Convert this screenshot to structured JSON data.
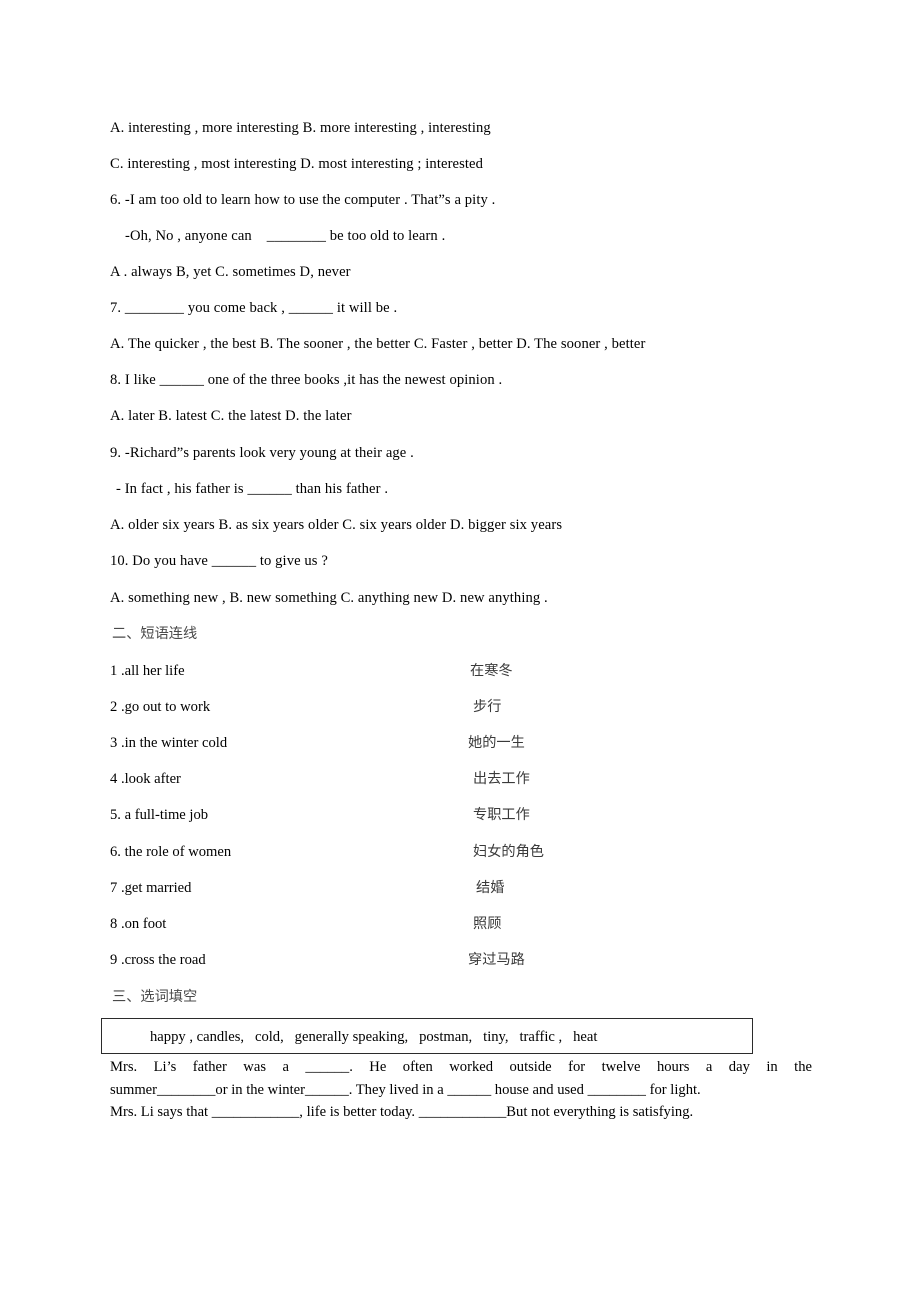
{
  "document": {
    "multiple_choice": {
      "lines": [
        {
          "id": "q5-options-ab",
          "text": "A. interesting , more interesting B. more interesting , interesting"
        },
        {
          "id": "q5-options-cd",
          "text": "C. interesting , most interesting D. most interesting ; interested"
        },
        {
          "id": "q6-stem",
          "text": "6. -I am too old to learn how to use the computer . That”s a pity ."
        },
        {
          "id": "q6-reply",
          "text": "-Oh, No , anyone can    ________ be too old to learn ."
        },
        {
          "id": "q6-options",
          "text": "A . always B, yet C. sometimes D, never"
        },
        {
          "id": "q7-stem",
          "text": "7. ________ you come back , ______ it will be ."
        },
        {
          "id": "q7-options",
          "text": "A. The quicker , the best B. The sooner , the better C. Faster , better D. The sooner , better"
        },
        {
          "id": "q8-stem",
          "text": "8. I like ______ one of the three books ,it has the newest opinion ."
        },
        {
          "id": "q8-options",
          "text": "A. later B. latest C. the latest D. the later"
        },
        {
          "id": "q9-stem",
          "text": "9. -Richard”s parents look very young at their age ."
        },
        {
          "id": "q9-reply",
          "text": "- In fact , his father is ______ than his father ."
        },
        {
          "id": "q9-options",
          "text": "A. older six years B. as six years older C. six years older D. bigger six years"
        },
        {
          "id": "q10-stem",
          "text": "10. Do you have ______ to give us ?"
        },
        {
          "id": "q10-options",
          "text": "A. something new , B. new something C. anything new D. new anything ."
        }
      ]
    },
    "section_two": {
      "heading": "二、短语连线",
      "english": [
        "1 .all her life",
        "2 .go out to work",
        "3 .in the winter cold",
        "4 .look after",
        "5. a full-time job",
        "6. the role of women",
        "7 .get married",
        "8 .on foot",
        "9 .cross the road"
      ],
      "chinese": [
        "在寒冬",
        "步行",
        "她的一生",
        "出去工作",
        "专职工作",
        "妇女的角色",
        "结婚",
        "照顾",
        "穿过马路"
      ]
    },
    "section_three": {
      "heading": "三、选词填空",
      "word_bank": "happy , candles,   cold,   generally speaking,   postman,   tiny,   traffic ,   heat",
      "paragraph_lines": [
        "Mrs.  Li’s  father  was  a  ______.  He  often  worked  outside  for  twelve  hours  a  day  in  the",
        "summer________or in the winter______. They lived in a ______ house and used ________ for light.",
        "Mrs. Li says that ____________, life is better today. ____________But not everything is satisfying."
      ]
    }
  }
}
